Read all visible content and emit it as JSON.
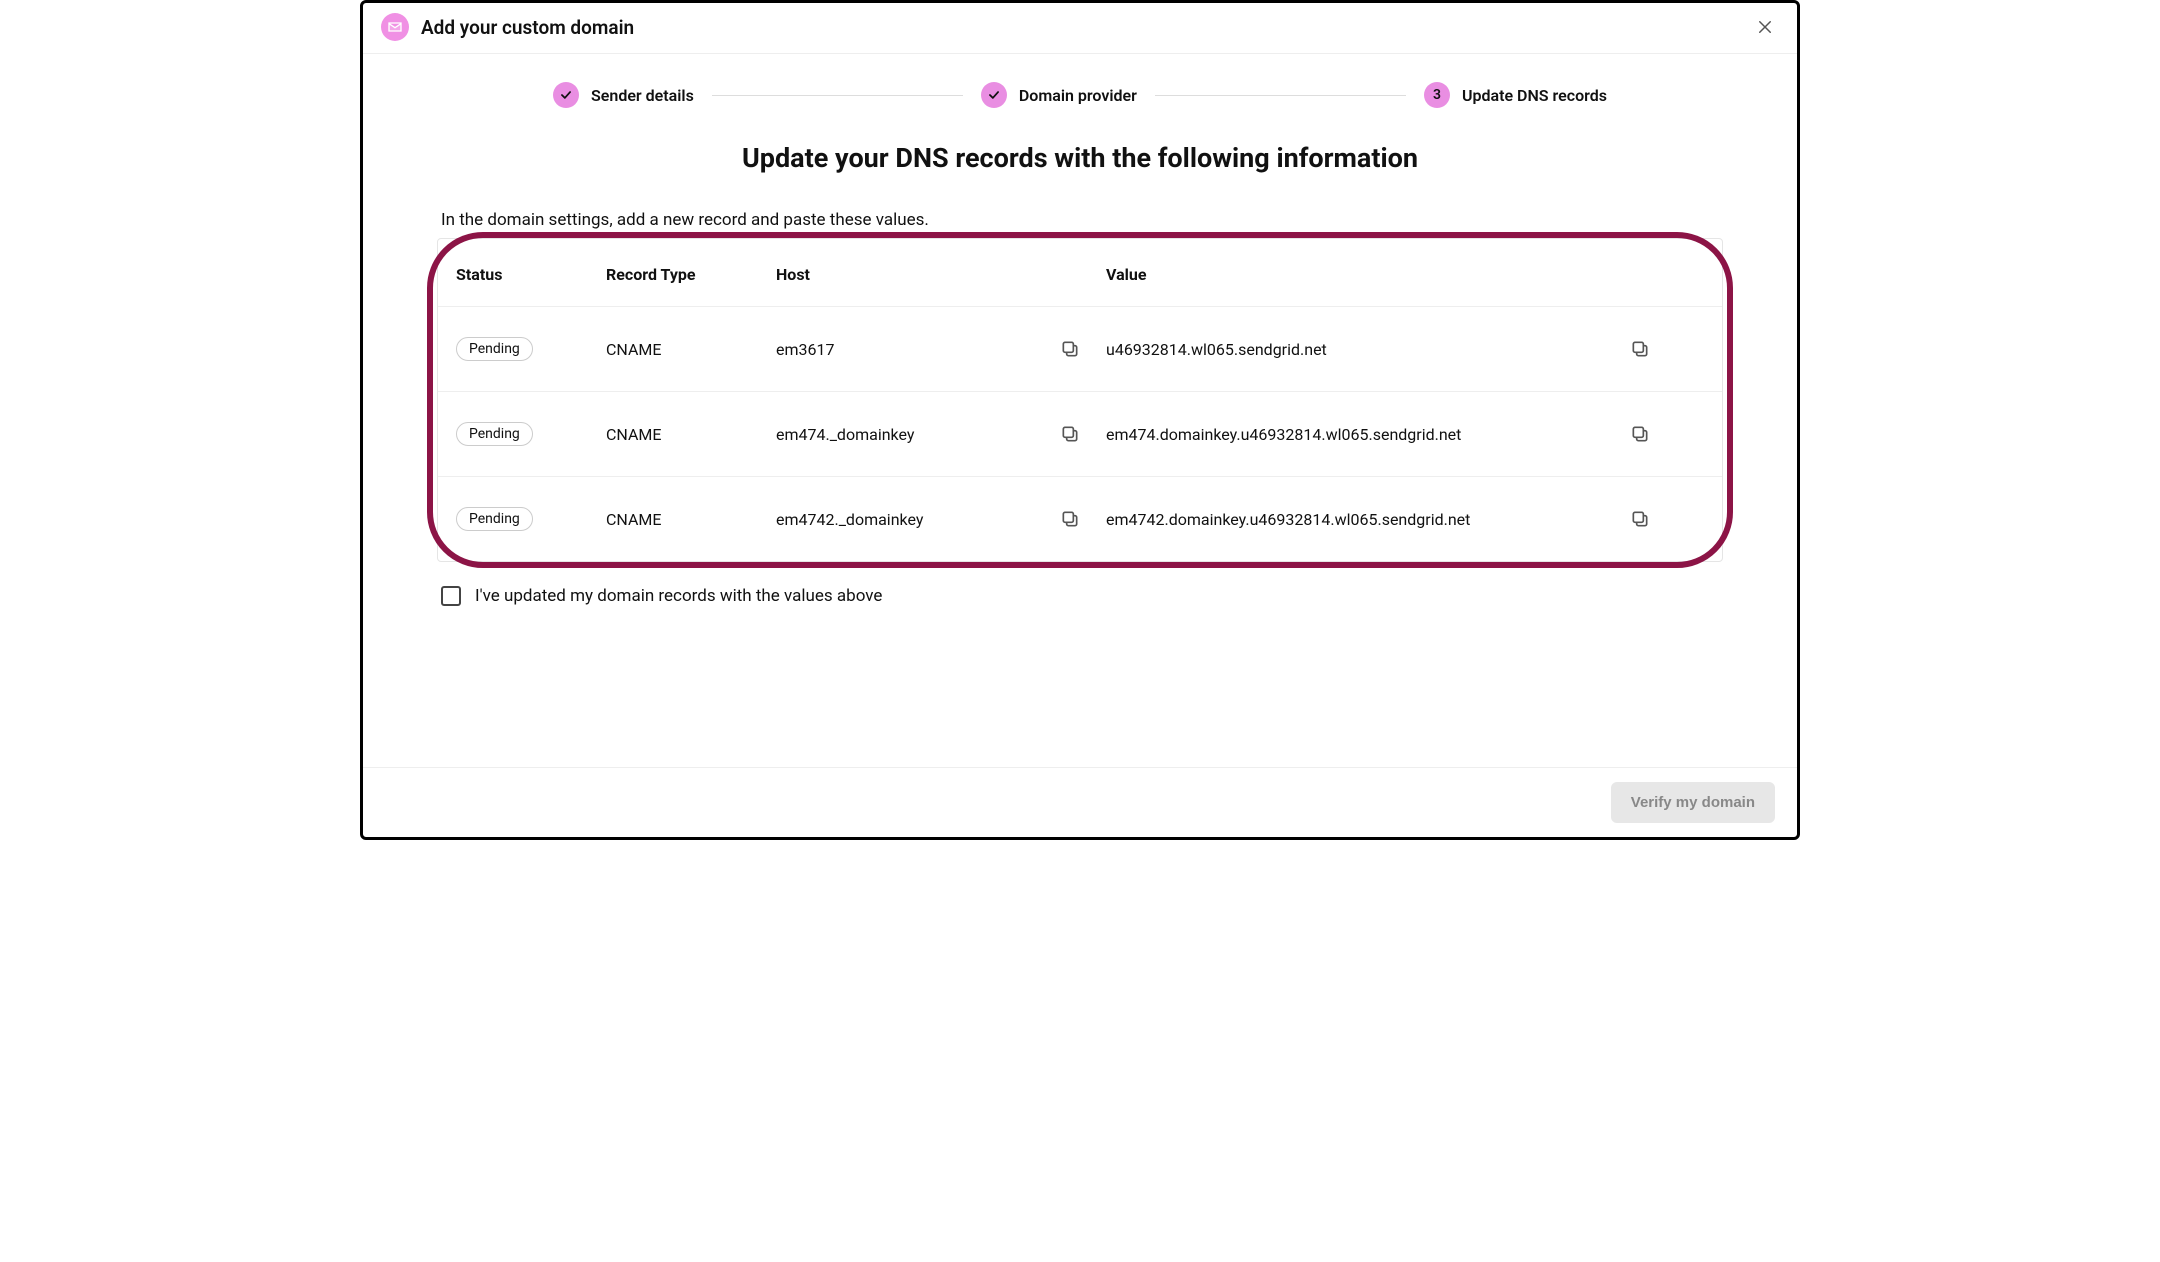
{
  "header": {
    "title": "Add your custom domain"
  },
  "stepper": {
    "steps": [
      {
        "label": "Sender details",
        "done": true
      },
      {
        "label": "Domain provider",
        "done": true
      },
      {
        "label": "Update DNS records",
        "done": false,
        "number": "3"
      }
    ]
  },
  "main": {
    "heading": "Update your DNS records with the following information",
    "instruction": "In the domain settings, add a new record and paste these values."
  },
  "table": {
    "columns": {
      "status": "Status",
      "record_type": "Record Type",
      "host": "Host",
      "value": "Value"
    },
    "rows": [
      {
        "status": "Pending",
        "record_type": "CNAME",
        "host": "em3617",
        "value": "u46932814.wl065.sendgrid.net"
      },
      {
        "status": "Pending",
        "record_type": "CNAME",
        "host": "em474._domainkey",
        "value": "em474.domainkey.u46932814.wl065.sendgrid.net"
      },
      {
        "status": "Pending",
        "record_type": "CNAME",
        "host": "em4742._domainkey",
        "value": "em4742.domainkey.u46932814.wl065.sendgrid.net"
      }
    ]
  },
  "confirm": {
    "label": "I've updated my domain records with the values above",
    "checked": false
  },
  "footer": {
    "verify_label": "Verify my domain"
  },
  "colors": {
    "accent": "#e98ee2",
    "highlight": "#8c1446"
  }
}
